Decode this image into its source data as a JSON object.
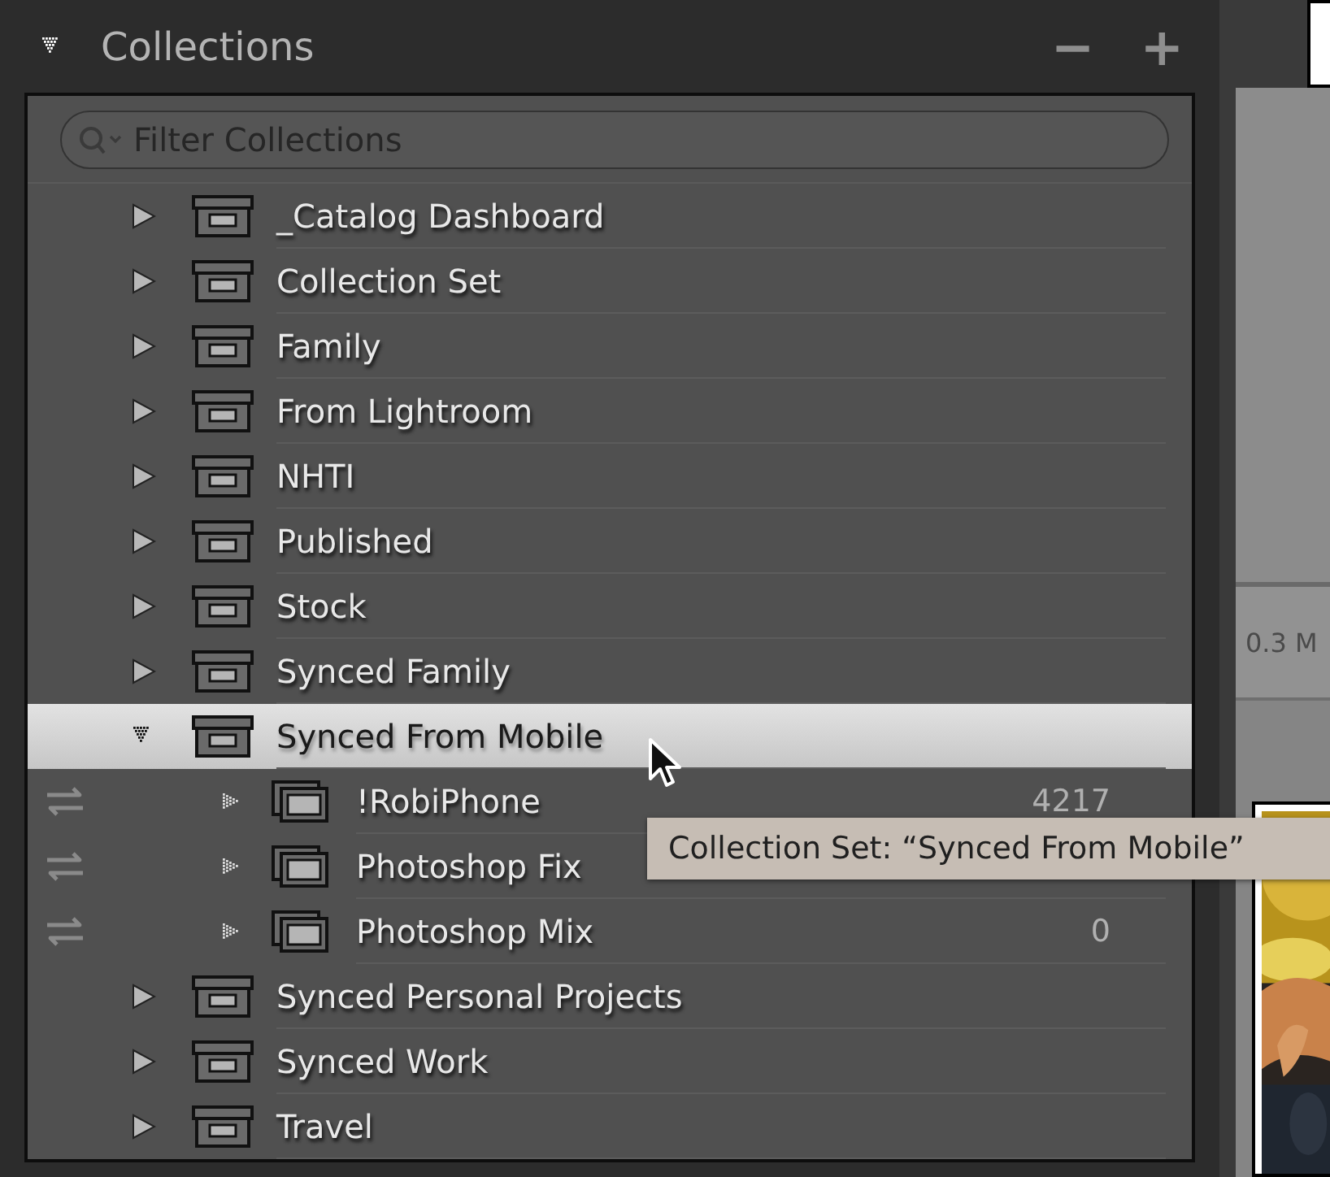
{
  "panel": {
    "title": "Collections",
    "expanded": true,
    "remove_button": "−",
    "add_button": "+"
  },
  "filter": {
    "placeholder": "Filter Collections"
  },
  "items": [
    {
      "name": "_Catalog Dashboard",
      "kind": "set",
      "expanded": false,
      "selected": false
    },
    {
      "name": "Collection Set",
      "kind": "set",
      "expanded": false,
      "selected": false
    },
    {
      "name": "Family",
      "kind": "set",
      "expanded": false,
      "selected": false
    },
    {
      "name": "From Lightroom",
      "kind": "set",
      "expanded": false,
      "selected": false
    },
    {
      "name": "NHTI",
      "kind": "set",
      "expanded": false,
      "selected": false
    },
    {
      "name": "Published",
      "kind": "set",
      "expanded": false,
      "selected": false
    },
    {
      "name": "Stock",
      "kind": "set",
      "expanded": false,
      "selected": false
    },
    {
      "name": "Synced Family",
      "kind": "set",
      "expanded": false,
      "selected": false
    },
    {
      "name": "Synced From Mobile",
      "kind": "set",
      "expanded": true,
      "selected": true,
      "children": [
        {
          "name": "!RobiPhone",
          "kind": "collection",
          "count": "4217",
          "synced": true,
          "selected": false
        },
        {
          "name": "Photoshop Fix",
          "kind": "collection",
          "synced": true,
          "selected": false
        },
        {
          "name": "Photoshop Mix",
          "kind": "collection",
          "count": "0",
          "synced": true,
          "selected": false
        }
      ]
    },
    {
      "name": "Synced Personal Projects",
      "kind": "set",
      "expanded": false,
      "selected": false
    },
    {
      "name": "Synced Work",
      "kind": "set",
      "expanded": false,
      "selected": false
    },
    {
      "name": "Travel",
      "kind": "set",
      "expanded": false,
      "selected": false
    }
  ],
  "tooltip": "Collection Set: “Synced From Mobile”",
  "side": {
    "size_label": "0.3 M"
  }
}
